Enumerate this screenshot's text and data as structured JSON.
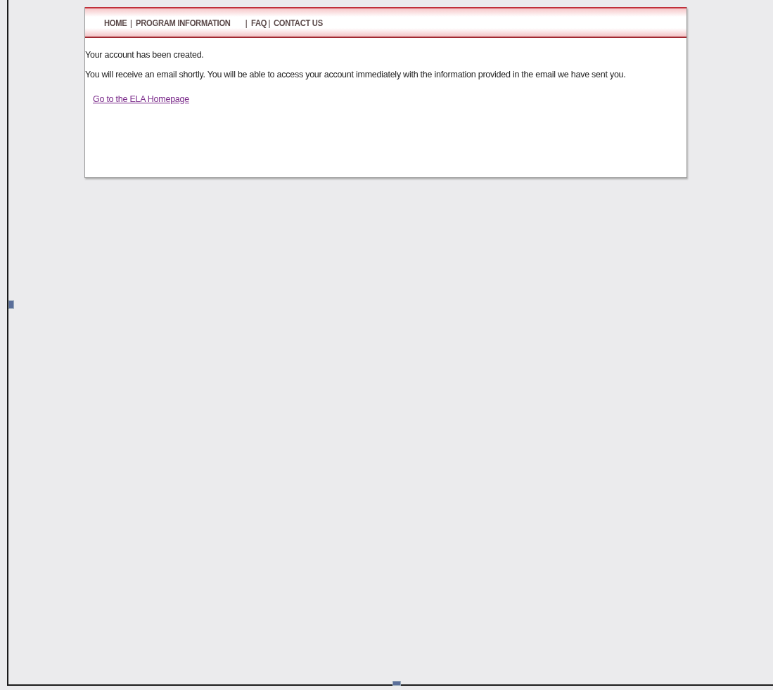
{
  "nav": {
    "items": [
      {
        "label": "HOME"
      },
      {
        "label": "PROGRAM INFORMATION"
      },
      {
        "label": "FAQ"
      },
      {
        "label": "CONTACT US"
      }
    ],
    "separator": "|"
  },
  "messages": [
    "Your account has been created.",
    "You will receive an email shortly. You will be able to access your account immediately with the information provided in the email we have sent you."
  ],
  "link": "Go to the ELA Homepage"
}
